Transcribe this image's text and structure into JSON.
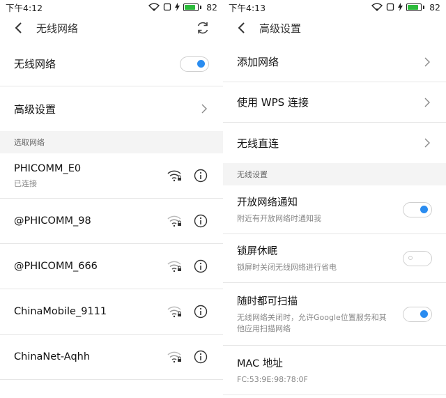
{
  "left": {
    "status": {
      "time": "下午4:12",
      "battery": "82"
    },
    "title": "无线网络",
    "wifi_toggle_label": "无线网络",
    "advanced_label": "高级设置",
    "section_label": "选取网络",
    "networks": [
      {
        "name": "PHICOMM_E0",
        "status": "已连接"
      },
      {
        "name": "@PHICOMM_98",
        "status": ""
      },
      {
        "name": "@PHICOMM_666",
        "status": ""
      },
      {
        "name": "ChinaMobile_9111",
        "status": ""
      },
      {
        "name": "ChinaNet-Aqhh",
        "status": ""
      }
    ]
  },
  "right": {
    "status": {
      "time": "下午4:13",
      "battery": "82"
    },
    "title": "高级设置",
    "items": [
      {
        "label": "添加网络"
      },
      {
        "label": "使用 WPS 连接"
      },
      {
        "label": "无线直连"
      }
    ],
    "section_label": "无线设置",
    "settings": [
      {
        "title": "开放网络通知",
        "desc": "附近有开放网络时通知我",
        "on": true
      },
      {
        "title": "锁屏休眠",
        "desc": "锁屏时关闭无线网络进行省电",
        "on": false
      },
      {
        "title": "随时都可扫描",
        "desc": "无线网络关闭时，允许Google位置服务和其他应用扫描网络",
        "on": true
      }
    ],
    "mac": {
      "title": "MAC 地址",
      "value": "FC:53:9E:98:78:0F"
    }
  },
  "colors": {
    "accent": "#2a8cf0",
    "battery": "#2dbb3c",
    "section_bg": "#f4f4f4"
  },
  "icons": [
    "back-icon",
    "refresh-icon",
    "chevron-right-icon",
    "wifi-lock-icon",
    "info-icon",
    "wifi-status-icon",
    "battery-icon"
  ]
}
